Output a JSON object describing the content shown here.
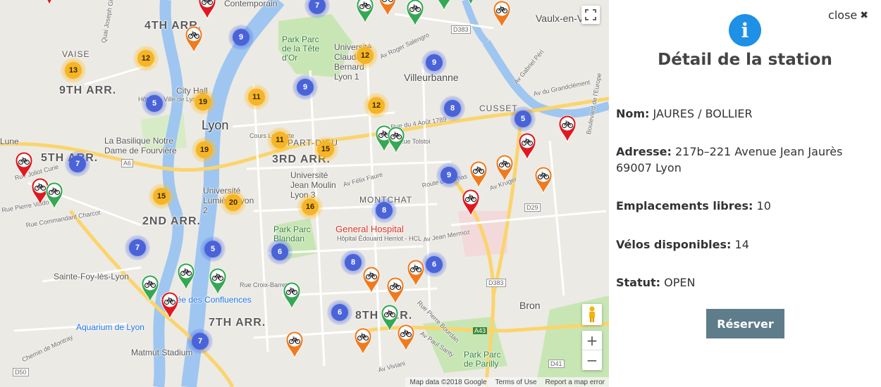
{
  "map": {
    "districts": [
      "4TH ARR.",
      "VAISE",
      "9TH ARR.",
      "5TH ARR.",
      "2ND ARR.",
      "3RD ARR.",
      "7TH ARR.",
      "8TH ARR.",
      "PART-DIEU",
      "CUSSET",
      "MONTCHAT"
    ],
    "cities": [
      "Lyon",
      "Villeurbanne",
      "Vaulx-en-Velin",
      "Bron",
      "Sainte-Foy-lès-Lyon",
      "Lune"
    ],
    "places": [
      "City Hall",
      "Hôtel de Ville de Lyon",
      "La Basilique Notre Dame de Fourvière",
      "Université Claude Bernard Lyon 1",
      "Park Parc de la Tête d'Or",
      "Université Lumière Lyon 2",
      "Université Jean Moulin Lyon 3",
      "Park Parc Blandan",
      "Musée des Confluences",
      "Aquarium de Lyon",
      "Matmut Stadium",
      "Park Parc de Parilly",
      "Contemporain"
    ],
    "hospital": "General Hospital",
    "hospital_sub": "Hôpital Édouard Herriot - HCL",
    "roads": [
      "Cours Lafayette",
      "Rue du 4 Août 1789",
      "Av Roger Salengro",
      "Route de Genas",
      "Rue Tolstoi",
      "Av Félix Faure",
      "Rue Croix-Barret",
      "Av Jean Mermoz",
      "Quai Joseph Gillet",
      "Rue Pierre Valdo",
      "Rue Commandant Charcot",
      "Av Kruger",
      "Av du Grandclément",
      "Av Gabriel Péri",
      "Chemin de Montray",
      "Rue Joliot Curie",
      "Boulevard de l'Europe",
      "Av Viviani",
      "Av Paul Santy",
      "Rue Pierre Bourdan"
    ],
    "route_shields": [
      "A6",
      "D383",
      "D29",
      "A43",
      "D41",
      "D50",
      "D383"
    ],
    "clusters": [
      7,
      9,
      12,
      13,
      12,
      5,
      19,
      11,
      9,
      12,
      9,
      8,
      5,
      19,
      11,
      15,
      7,
      15,
      20,
      16,
      8,
      9,
      7,
      5,
      6,
      8,
      6,
      6,
      7
    ],
    "marker_colors": {
      "red": "#e0181f",
      "orange": "#f07a1e",
      "green": "#34a853"
    },
    "footer": [
      "Map data ©2018 Google",
      "Terms of Use",
      "Report a map error"
    ],
    "zoom_in": "+",
    "zoom_out": "−"
  },
  "panel": {
    "close_label": "close",
    "close_icon": "✖",
    "info_icon": "i",
    "title": "Détail de la station",
    "fields": {
      "name_label": "Nom:",
      "name_value": "JAURES / BOLLIER",
      "address_label": "Adresse:",
      "address_value": "217b–221 Avenue Jean Jaurès 69007 Lyon",
      "free_label": "Emplacements libres:",
      "free_value": "10",
      "bikes_label": "Vélos disponibles:",
      "bikes_value": "14",
      "status_label": "Statut:",
      "status_value": "OPEN"
    },
    "reserve_label": "Réserver",
    "accent": "#1e90e6",
    "button_color": "#5f7c8a"
  }
}
